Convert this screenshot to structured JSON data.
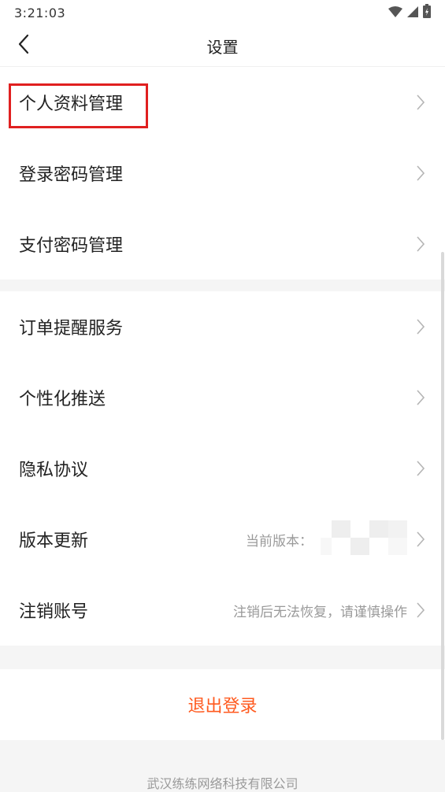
{
  "status_bar": {
    "time": "3:21:03",
    "icons": [
      "wifi-icon",
      "signal-icon",
      "battery-icon"
    ]
  },
  "nav": {
    "title": "设置",
    "back_icon": "back-arrow-icon"
  },
  "group1": [
    {
      "label": "个人资料管理"
    },
    {
      "label": "登录密码管理"
    },
    {
      "label": "支付密码管理"
    }
  ],
  "group2": [
    {
      "label": "订单提醒服务"
    },
    {
      "label": "个性化推送"
    },
    {
      "label": "隐私协议"
    },
    {
      "label": "版本更新",
      "value": "当前版本："
    },
    {
      "label": "注销账号",
      "value": "注销后无法恢复，请谨慎操作"
    }
  ],
  "logout": {
    "label": "退出登录"
  },
  "footer": {
    "company": "武汉练练网络科技有限公司"
  },
  "colors": {
    "accent": "#ff5a1f",
    "highlight": "#e02020",
    "muted": "#9a9a9a"
  }
}
